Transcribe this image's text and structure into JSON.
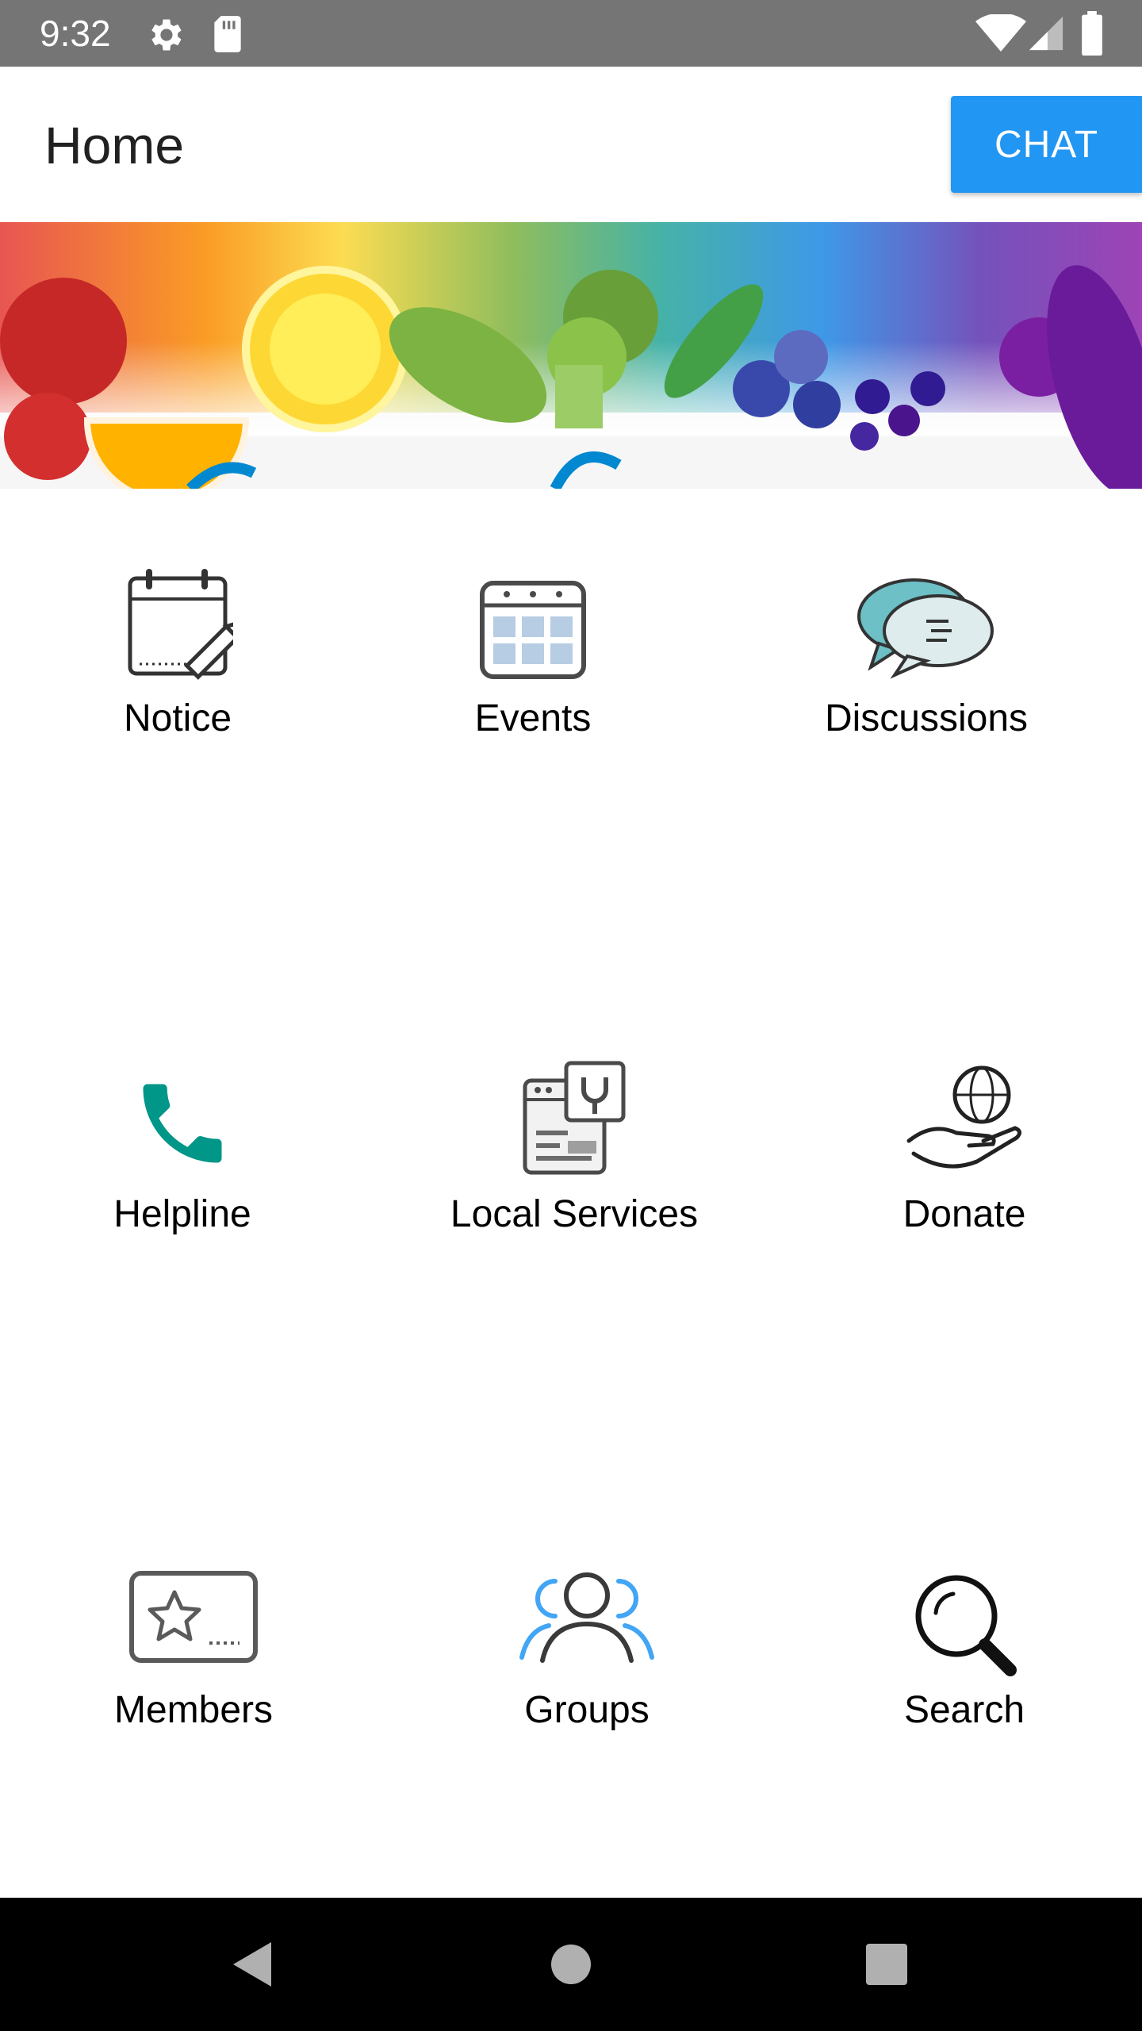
{
  "status_bar": {
    "time": "9:32",
    "icons": [
      "gear-icon",
      "sd-card-icon",
      "wifi-icon",
      "signal-icon",
      "battery-icon"
    ]
  },
  "app_bar": {
    "title": "Home",
    "chat_label": "CHAT",
    "chat_color": "#2196f3"
  },
  "banner": {
    "image": "watercolor-fruit-vegetable-banner"
  },
  "menu": {
    "items": [
      {
        "label": "Notice",
        "icon": "notice-calendar-pencil-icon"
      },
      {
        "label": "Events",
        "icon": "events-calendar-icon"
      },
      {
        "label": "Discussions",
        "icon": "discussions-chat-bubbles-icon"
      },
      {
        "label": "Helpline",
        "icon": "phone-icon"
      },
      {
        "label": "Local Services",
        "icon": "local-services-icon"
      },
      {
        "label": "Donate",
        "icon": "donate-hand-globe-icon"
      },
      {
        "label": "Members",
        "icon": "members-star-card-icon"
      },
      {
        "label": "Groups",
        "icon": "groups-people-icon"
      },
      {
        "label": "Search",
        "icon": "search-icon"
      }
    ]
  },
  "nav_bar": {
    "icons": [
      "back-icon",
      "home-icon",
      "recents-icon"
    ]
  }
}
